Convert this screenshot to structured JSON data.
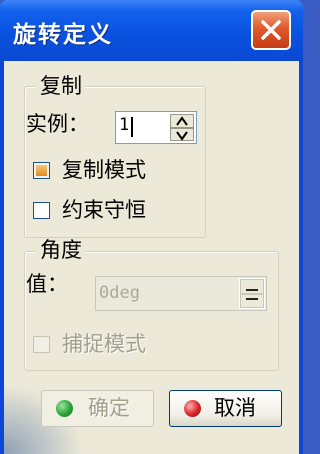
{
  "window": {
    "title": "旋转定义",
    "close_icon": "close-x-icon"
  },
  "copy_group": {
    "legend": "复制",
    "instances_label": "实例：",
    "instances_value": "1",
    "copy_mode_label": "复制模式",
    "copy_mode_checked": true,
    "constraint_label": "约束守恒",
    "constraint_checked": false
  },
  "angle_group": {
    "legend": "角度",
    "value_label": "值：",
    "value": "0deg",
    "snap_label": "捕捉模式",
    "snap_checked": true,
    "enabled": false
  },
  "buttons": {
    "ok_label": "确定",
    "ok_enabled": false,
    "cancel_label": "取消"
  },
  "colors": {
    "title_bar": "#0a52e0",
    "close_button": "#e05a2c",
    "ok_dot": "#2aa33a",
    "cancel_dot": "#d8232a",
    "client_bg": "#ece9d8"
  }
}
